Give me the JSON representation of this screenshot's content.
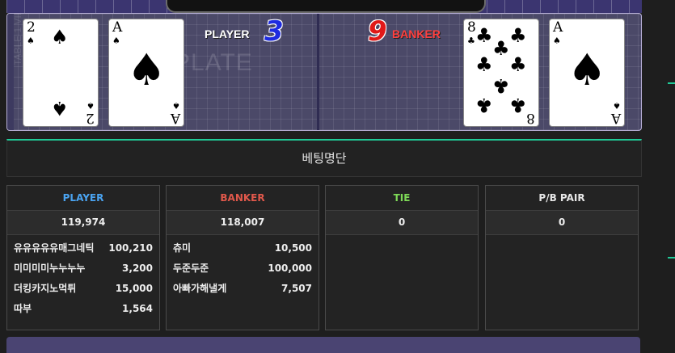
{
  "board": {
    "watermark": "PLATE",
    "side_text": "TABLE 1 VIEW",
    "player": {
      "label": "PLAYER",
      "score": "3",
      "cards": [
        {
          "rank": "2",
          "suit": "♠",
          "suit_name": "spade"
        },
        {
          "rank": "A",
          "suit": "♠",
          "suit_name": "spade"
        }
      ]
    },
    "banker": {
      "label": "BANKER",
      "score": "9",
      "cards": [
        {
          "rank": "8",
          "suit": "♣",
          "suit_name": "club"
        },
        {
          "rank": "A",
          "suit": "♠",
          "suit_name": "spade"
        }
      ]
    },
    "colors": {
      "player_score": "#1e2be0",
      "banker_score": "#e01818"
    }
  },
  "betting_list": {
    "title": "베팅명단",
    "columns": [
      {
        "name": "PLAYER",
        "color": "#4aa3f0",
        "total": "119,974",
        "rows": [
          {
            "user": "유유유유유매그네틱",
            "amount": "100,210"
          },
          {
            "user": "미미미미누누누누",
            "amount": "3,200"
          },
          {
            "user": "더킹카지노먹튀",
            "amount": "15,000"
          },
          {
            "user": "따부",
            "amount": "1,564"
          }
        ]
      },
      {
        "name": "BANKER",
        "color": "#e0584b",
        "total": "118,007",
        "rows": [
          {
            "user": "츄미",
            "amount": "10,500"
          },
          {
            "user": "두준두준",
            "amount": "100,000"
          },
          {
            "user": "아빠가해낼게",
            "amount": "7,507"
          }
        ]
      },
      {
        "name": "TIE",
        "color": "#7ed957",
        "total": "0",
        "rows": []
      },
      {
        "name": "P/B PAIR",
        "color": "#e6e6e6",
        "total": "0",
        "rows": []
      }
    ]
  }
}
